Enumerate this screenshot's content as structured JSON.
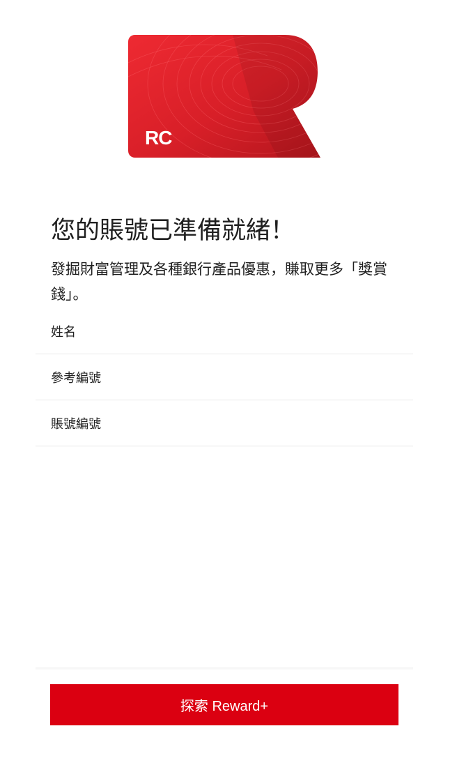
{
  "card": {
    "brand_text": "RC",
    "icon": "reward-card-icon",
    "color_primary": "#e4202b",
    "color_dark": "#b8161e"
  },
  "headline": "您的賬號已準備就緒！",
  "subtitle": "發掘財富管理及各種銀行產品優惠，賺取更多「獎賞錢」。",
  "info_rows": [
    {
      "label": "姓名"
    },
    {
      "label": "參考編號"
    },
    {
      "label": "賬號編號"
    }
  ],
  "cta": {
    "label": "探索 Reward+",
    "color": "#db0011"
  }
}
